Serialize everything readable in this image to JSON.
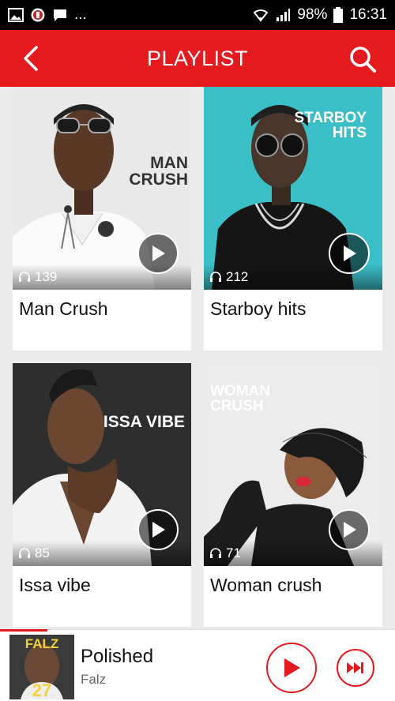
{
  "status_bar": {
    "left_extra": "...",
    "battery": "98%",
    "time": "16:31"
  },
  "header": {
    "title": "PLAYLIST"
  },
  "playlists": [
    {
      "name": "Man Crush",
      "listens": "139",
      "overlay_lines": [
        "MAN",
        "CRUSH"
      ]
    },
    {
      "name": "Starboy hits",
      "listens": "212",
      "overlay_lines": [
        "STARBOY",
        "HITS"
      ]
    },
    {
      "name": "Issa vibe",
      "listens": "85",
      "overlay_lines": [
        "ISSA VIBE"
      ]
    },
    {
      "name": "Woman crush",
      "listens": "71",
      "overlay_lines": [
        "WOMAN",
        "CRUSH"
      ]
    }
  ],
  "now_playing": {
    "title": "Polished",
    "artist": "Falz",
    "cover_text": "FALZ",
    "cover_number": "27",
    "progress": 0.12
  },
  "colors": {
    "brand_red": "#e41a1f"
  },
  "icons": {
    "back": "chevron-left-icon",
    "search": "search-icon",
    "headphones": "headphones-icon",
    "play": "play-icon",
    "next": "skip-next-icon"
  }
}
